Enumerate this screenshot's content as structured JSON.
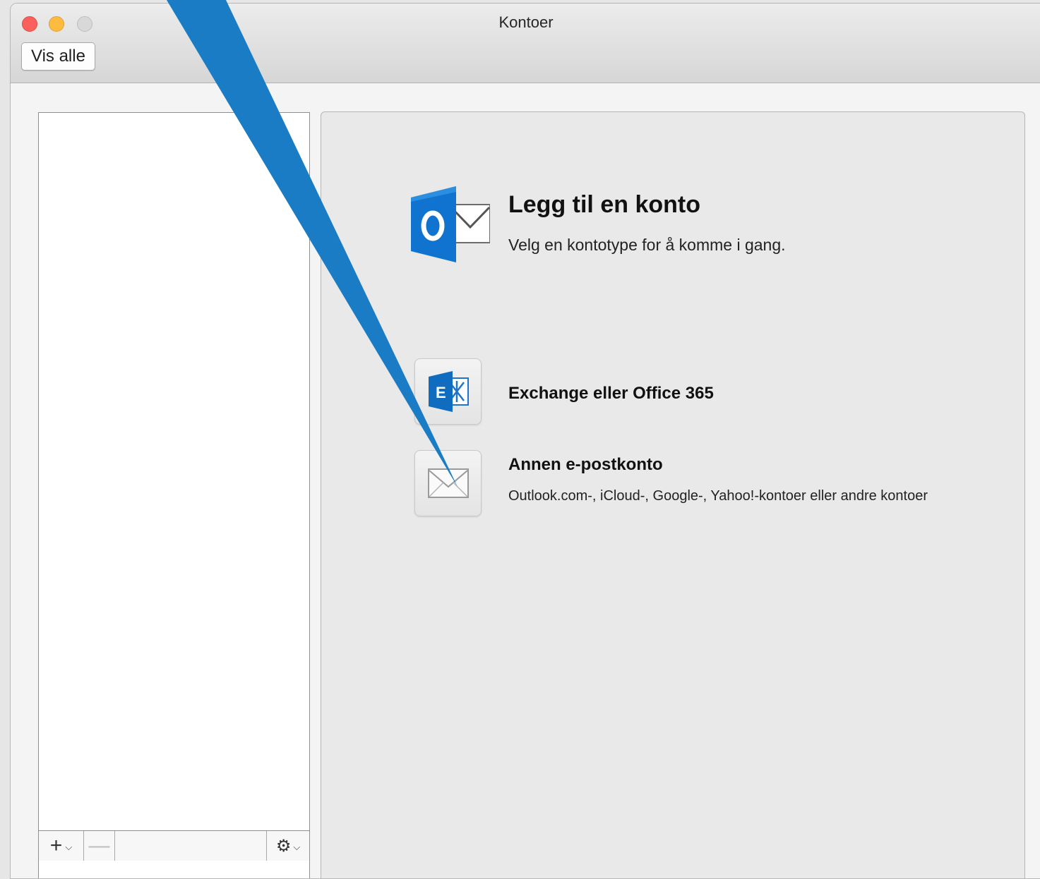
{
  "window": {
    "title": "Kontoer",
    "show_all_label": "Vis alle"
  },
  "account_list": {
    "items": [],
    "toolbar": {
      "add_label": "+",
      "remove_label": "—",
      "gear_icon": "gear-icon"
    }
  },
  "main": {
    "heading": "Legg til en konto",
    "subheading": "Velg en kontotype for å komme i gang.",
    "options": [
      {
        "label": "Exchange eller Office 365",
        "icon": "exchange-icon"
      },
      {
        "label": "Annen e-postkonto",
        "description": "Outlook.com-, iCloud-, Google-, Yahoo!-kontoer eller andre kontoer",
        "icon": "envelope-icon"
      }
    ]
  },
  "colors": {
    "callout": "#1a7cc4",
    "outlook_blue": "#0f73cf",
    "close": "#fc605c",
    "minimize": "#fdbc40"
  }
}
